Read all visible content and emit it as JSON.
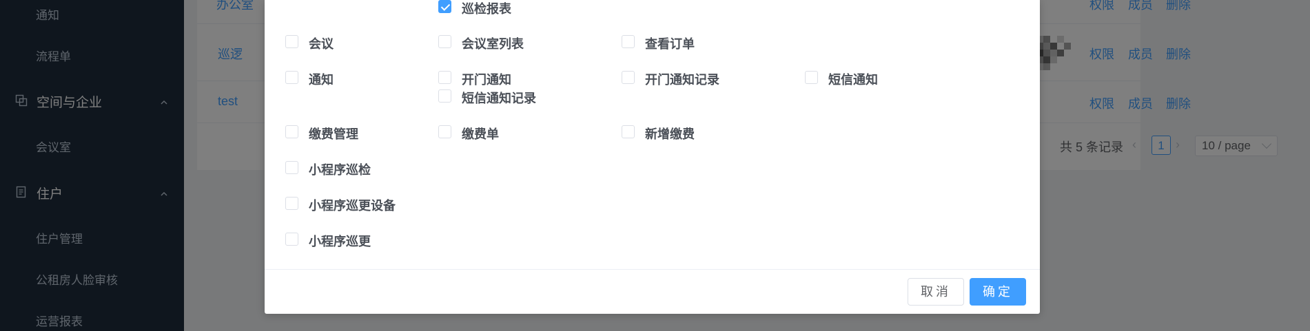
{
  "sidebar": {
    "items": [
      {
        "label": "通知"
      },
      {
        "label": "流程单"
      },
      {
        "label": "空间与企业"
      },
      {
        "label": "会议室"
      },
      {
        "label": "住户"
      },
      {
        "label": "住户管理"
      },
      {
        "label": "公租房人脸审核"
      },
      {
        "label": "运营报表"
      }
    ]
  },
  "table": {
    "rows": [
      {
        "name": "办公室",
        "actions": [
          "权限",
          "成员",
          "删除"
        ]
      },
      {
        "name": "巡逻",
        "actions": [
          "权限",
          "成员",
          "删除"
        ]
      },
      {
        "name": "test",
        "actions": [
          "权限",
          "成员",
          "删除"
        ]
      }
    ]
  },
  "pagination": {
    "total_text": "共 5 条记录",
    "current_page": "1",
    "page_size": "10 / page"
  },
  "dialog": {
    "checkboxes": [
      {
        "label": "巡检报表",
        "checked": true
      },
      {
        "label": "会议",
        "checked": false
      },
      {
        "label": "会议室列表",
        "checked": false
      },
      {
        "label": "查看订单",
        "checked": false
      },
      {
        "label": "通知",
        "checked": false
      },
      {
        "label": "开门通知",
        "checked": false
      },
      {
        "label": "开门通知记录",
        "checked": false
      },
      {
        "label": "短信通知",
        "checked": false
      },
      {
        "label": "短信通知记录",
        "checked": false
      },
      {
        "label": "缴费管理",
        "checked": false
      },
      {
        "label": "缴费单",
        "checked": false
      },
      {
        "label": "新增缴费",
        "checked": false
      },
      {
        "label": "小程序巡检",
        "checked": false
      },
      {
        "label": "小程序巡更设备",
        "checked": false
      },
      {
        "label": "小程序巡更",
        "checked": false
      }
    ],
    "cancel_label": "取消",
    "confirm_label": "确定"
  },
  "colors": {
    "sidebar_bg": "#1f2d3d",
    "primary": "#409eff",
    "overlay": "rgba(0,0,0,0.5)"
  },
  "icons": {
    "space": "layers-icon",
    "resident": "document-icon",
    "collapse": "chevron-up-icon",
    "check": "check-icon"
  }
}
